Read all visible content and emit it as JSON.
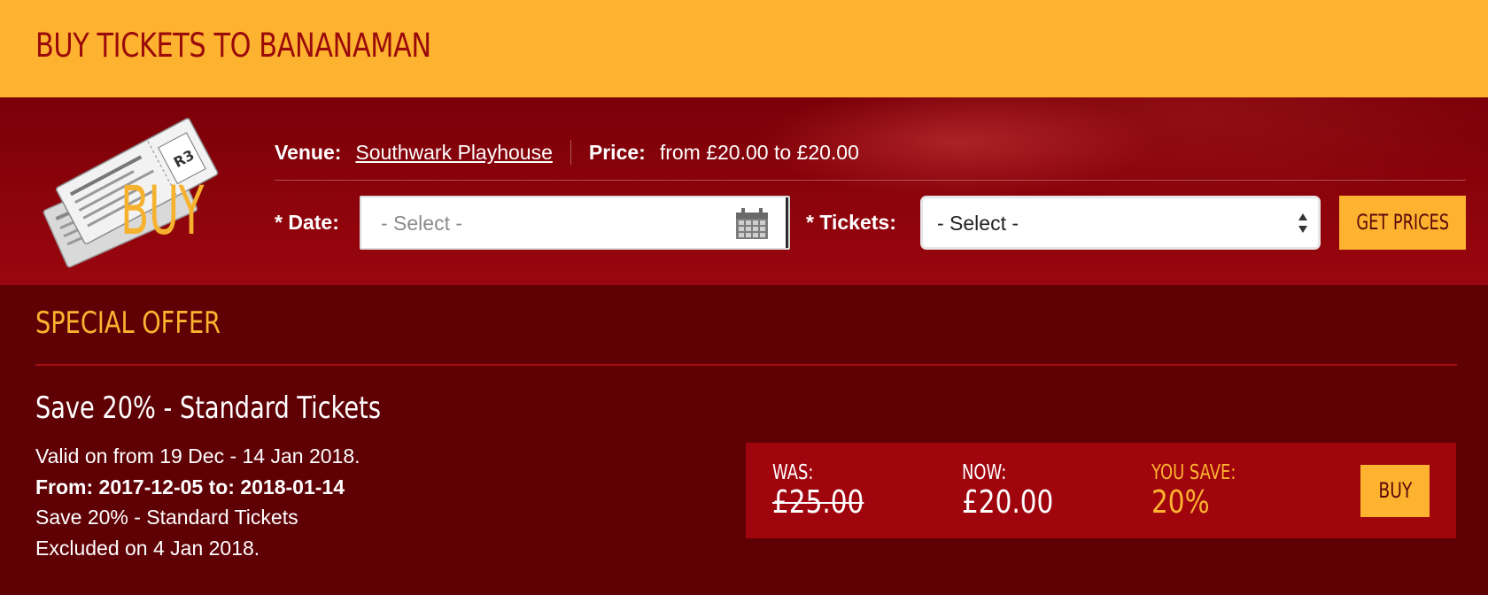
{
  "header": {
    "title": "BUY TICKETS TO BANANAMAN"
  },
  "buy_panel": {
    "logo_text": "BUY",
    "ticket_stub_text": "R3",
    "venue_label": "Venue:",
    "venue_name": "Southwark Playhouse",
    "price_label": "Price:",
    "price_range": "from £20.00 to £20.00",
    "date_label": "* Date:",
    "date_placeholder": "- Select -",
    "tickets_label": "* Tickets:",
    "tickets_selected": "- Select -",
    "get_prices_label": "GET PRICES"
  },
  "special_offer": {
    "heading": "SPECIAL OFFER",
    "deal_title": "Save 20% - Standard Tickets",
    "lines": {
      "valid": "Valid on from 19 Dec - 14 Jan 2018.",
      "range": "From: 2017-12-05 to: 2018-01-14",
      "summary": "Save 20% - Standard Tickets",
      "excluded": "Excluded on 4 Jan 2018."
    },
    "pricing": {
      "was_label": "WAS:",
      "was_value": "£25.00",
      "now_label": "NOW:",
      "now_value": "£20.00",
      "save_label": "YOU SAVE:",
      "save_value": "20%",
      "buy_label": "BUY"
    }
  },
  "colors": {
    "accent_yellow": "#fdb32f",
    "header_red_text": "#9b0a0b",
    "panel_red": "#8c030b",
    "dark_maroon": "#5f0005",
    "price_box_red": "#a0050e"
  }
}
